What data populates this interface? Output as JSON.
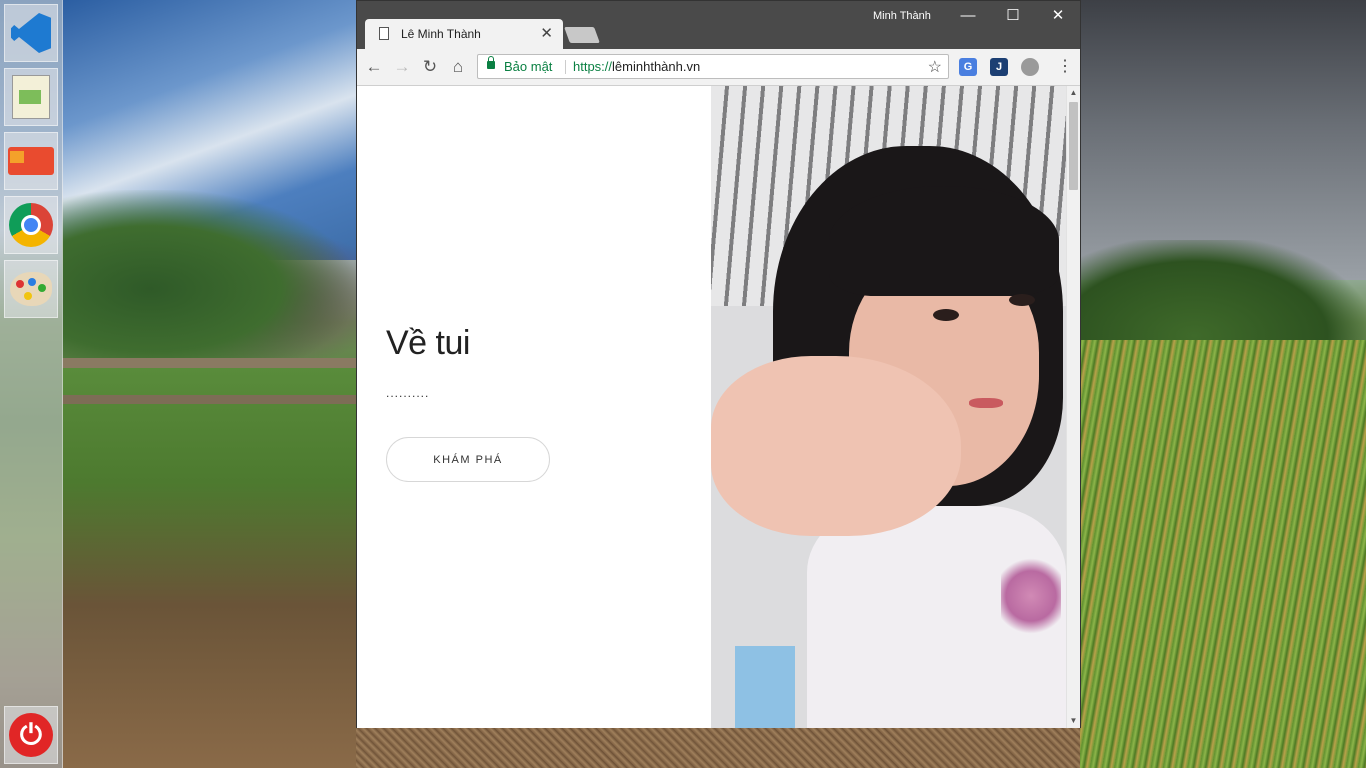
{
  "browser": {
    "user_name": "Minh Thành",
    "tab": {
      "title": "Lê Minh Thành",
      "close_glyph": "✕"
    },
    "window_controls": {
      "minimize": "—",
      "maximize": "☐",
      "close": "✕"
    },
    "toolbar": {
      "back_glyph": "←",
      "forward_glyph": "→",
      "reload_glyph": "↻",
      "home_glyph": "⌂",
      "secure_label": "Bảo mật",
      "url_protocol": "https://",
      "url_host": "lêminhthành.vn",
      "star_glyph": "☆",
      "menu_glyph": "⋮",
      "extensions": [
        {
          "name": "google-translate-icon",
          "label": "G",
          "color": "#4a7fe0"
        },
        {
          "name": "j-extension-icon",
          "label": "J",
          "color": "#1c3f73"
        },
        {
          "name": "cloud-extension-icon",
          "label": "",
          "color": "#9a9a9a"
        }
      ]
    },
    "scrollbar": {
      "up_glyph": "▲",
      "down_glyph": "▼"
    }
  },
  "page": {
    "heading": "Về tui",
    "dots": "..........",
    "cta_label": "KHÁM PHÁ"
  },
  "dock": {
    "items": [
      {
        "name": "vscode-icon"
      },
      {
        "name": "notepad-icon"
      },
      {
        "name": "moving-truck-icon"
      },
      {
        "name": "chrome-icon"
      },
      {
        "name": "paint-palette-icon"
      },
      {
        "name": "power-icon",
        "glyph": "⏻"
      }
    ]
  },
  "colors": {
    "secure_green": "#0b8043",
    "titlebar": "#4a4a4a",
    "power_red": "#e12626"
  }
}
